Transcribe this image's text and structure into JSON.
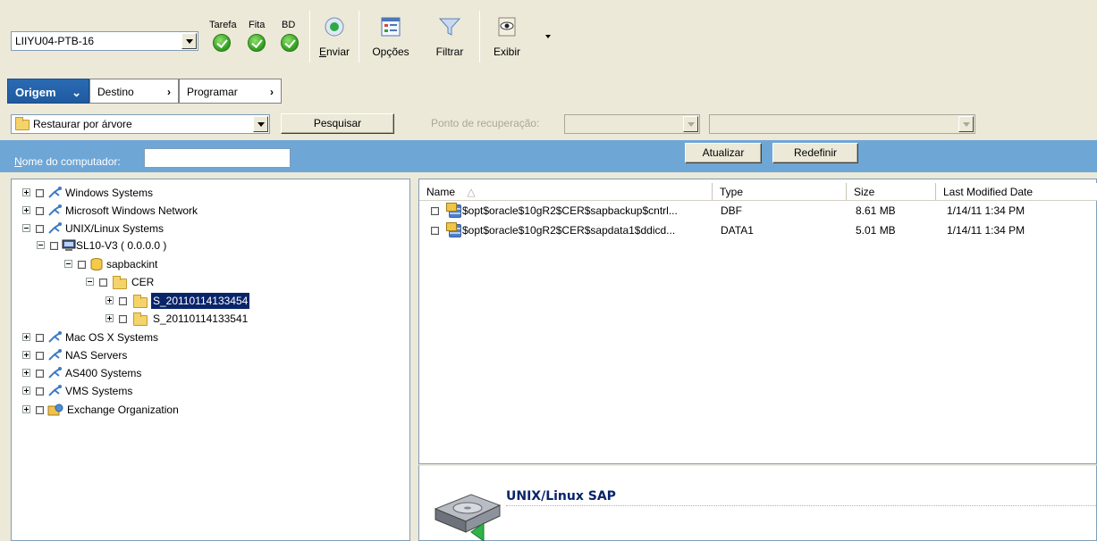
{
  "toolbar": {
    "server": "LIIYU04-PTB-16",
    "status_labels": [
      "Tarefa",
      "Fita",
      "BD"
    ],
    "buttons": {
      "submit": "Enviar",
      "options": "Opções",
      "filter": "Filtrar",
      "view": "Exibir"
    }
  },
  "tabs": {
    "source": "Origem",
    "destination": "Destino",
    "schedule": "Programar"
  },
  "restore": {
    "mode": "Restaurar por árvore",
    "search_button": "Pesquisar",
    "recovery_point_label": "Ponto de recuperação:"
  },
  "filter_bar": {
    "computer_name_label": "Nome do computador:",
    "computer_name_value": "",
    "refresh_button": "Atualizar",
    "reset_button": "Redefinir"
  },
  "tree": [
    {
      "label": "Windows Systems"
    },
    {
      "label": "Microsoft Windows Network"
    },
    {
      "label": "UNIX/Linux Systems"
    },
    {
      "label": "SL10-V3 ( 0.0.0.0 )"
    },
    {
      "label": "sapbackint"
    },
    {
      "label": "CER"
    },
    {
      "label": "S_20110114133454"
    },
    {
      "label": "S_20110114133541"
    },
    {
      "label": "Mac OS X Systems"
    },
    {
      "label": "NAS Servers"
    },
    {
      "label": "AS400 Systems"
    },
    {
      "label": "VMS Systems"
    },
    {
      "label": "Exchange Organization"
    }
  ],
  "file_list": {
    "columns": [
      "Name",
      "Type",
      "Size",
      "Last Modified Date"
    ],
    "rows": [
      {
        "name": "$opt$oracle$10gR2$CER$sapbackup$cntrl...",
        "type": "DBF",
        "size": "8.61 MB",
        "date": "1/14/11  1:34 PM"
      },
      {
        "name": "$opt$oracle$10gR2$CER$sapdata1$ddicd...",
        "type": "DATA1",
        "size": "5.01 MB",
        "date": "1/14/11  1:34 PM"
      }
    ]
  },
  "detail": {
    "title": "UNIX/Linux SAP"
  },
  "colors": {
    "filter_bar": "#6ea6d6",
    "active_tab": "#1f5aa0",
    "selection": "#0a246a"
  }
}
